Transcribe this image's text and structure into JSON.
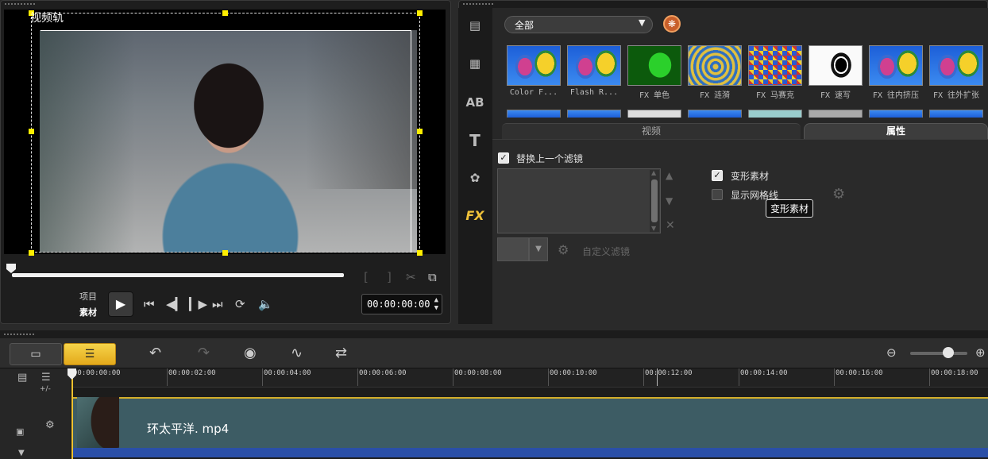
{
  "preview": {
    "track_label": "视频轨",
    "mode_project": "项目",
    "mode_clip": "素材",
    "timecode": "00:00:00:00"
  },
  "library": {
    "category": "全部",
    "thumbnails": [
      {
        "label": "Color F..."
      },
      {
        "label": "Flash R..."
      },
      {
        "label": "FX 单色"
      },
      {
        "label": "FX 涟漪"
      },
      {
        "label": "FX 马赛克"
      },
      {
        "label": "FX 速写"
      },
      {
        "label": "FX 往内挤压"
      },
      {
        "label": "FX 往外扩张"
      }
    ],
    "tabs": {
      "video": "视频",
      "properties": "属性"
    }
  },
  "properties": {
    "replace_filter": "替换上一个滤镜",
    "custom_filter": "自定义滤镜",
    "distort_clip": "变形素材",
    "show_grid": "显示网格线",
    "tooltip": "变形素材"
  },
  "timeline": {
    "ruler": [
      "00:00:00:00",
      "00:00:02:00",
      "00:00:04:00",
      "00:00:06:00",
      "00:00:08:00",
      "00:00:10:00",
      "00:00:12:00",
      "00:00:14:00",
      "00:00:16:00",
      "00:00:18:00"
    ],
    "clip_name": "环太平洋. mp4",
    "add_remove": "+/-"
  },
  "colors": {
    "accent": "#f2c230",
    "clip": "#3d5c64",
    "audio": "#2a4fa8"
  }
}
